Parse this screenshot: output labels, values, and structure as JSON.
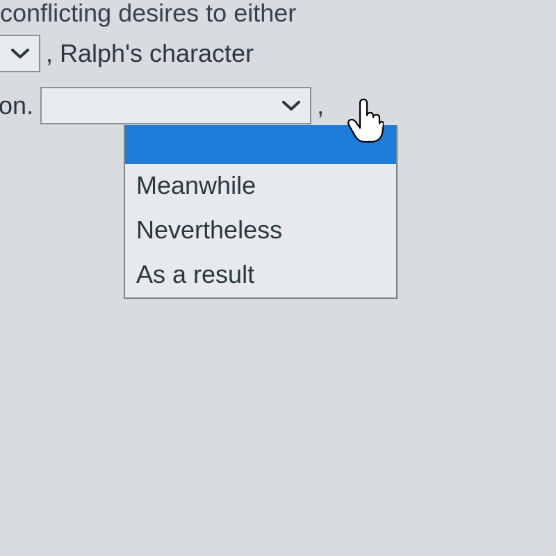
{
  "text": {
    "line1": "e conflicting desires to either",
    "line2_after": ", Ralph's character",
    "line3_prefix": "oition.",
    "line3_after": ","
  },
  "select1": {
    "value": ""
  },
  "select2": {
    "value": ""
  },
  "dropdown": {
    "items": [
      "",
      "Meanwhile",
      "Nevertheless",
      "As a result"
    ]
  },
  "colors": {
    "highlight": "#1f7dd9",
    "border": "#7c838c",
    "bg": "#d8dce0",
    "text": "#2a3840"
  }
}
